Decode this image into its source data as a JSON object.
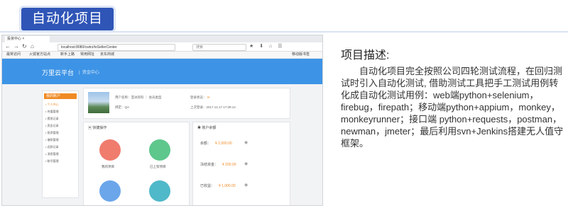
{
  "slide": {
    "title": "自动化项目",
    "desc_title": "项目描述:",
    "desc_body": "自动化项目完全按照公司四轮测试流程，在回归测试时引入自动化测试, 借助测试工具把手工测试用例转化成自动化测试用例：web端python+selenium，firebug，firepath；移动端python+appium，monkey，monkeyrunner；接口端 python+requests，postman，newman，jmeter；最后利用svn+Jenkins搭建无人值守框架。"
  },
  "browser": {
    "tab_label": "投资中心 ×",
    "url": "localhost:8080/cwtrz/toSellerCenter",
    "search_placeholder": "搜索",
    "nav_icons": [
      "back-icon",
      "forward-icon",
      "refresh-icon",
      "home-icon"
    ],
    "bookmarks": [
      "最常访问",
      "火狐官方站点",
      "新手上路",
      "常用网址",
      "京东商城"
    ],
    "bookmarks_right": "移动版书签"
  },
  "site": {
    "brand": "万里云平台",
    "section": "资金中心",
    "sidebar_title": "我的账户",
    "sidebar_items": [
      "个人中心",
      "充值管理",
      "提现记录",
      "资金记录",
      "投资管理",
      "借款管理",
      "还款记录",
      "消息管理",
      "账号管理"
    ],
    "profile": {
      "name_line": "用户名称：亚洲资料 ｜ 会员类型",
      "tag_line": "绑定：QA",
      "login_label": "登录状态：",
      "time_line": "上次登录：2017.12.17 17:09:14"
    },
    "quick_ops": {
      "title": "快捷操作",
      "items": [
        {
          "label": "我的项目",
          "color": "#f07c6e"
        },
        {
          "label": "已上架项目",
          "color": "#5dc78c"
        },
        {
          "label": "",
          "color": "#6ba6ea"
        },
        {
          "label": "",
          "color": "#4fb8c9"
        }
      ]
    },
    "account": {
      "title": "账户余额",
      "rows": [
        {
          "label": "余额：",
          "amount": "¥ 2,000.00"
        },
        {
          "label": "冻结资金：",
          "amount": "¥ 200.00"
        },
        {
          "label": "已收益：",
          "amount": "¥ 1,000.00"
        }
      ]
    }
  }
}
